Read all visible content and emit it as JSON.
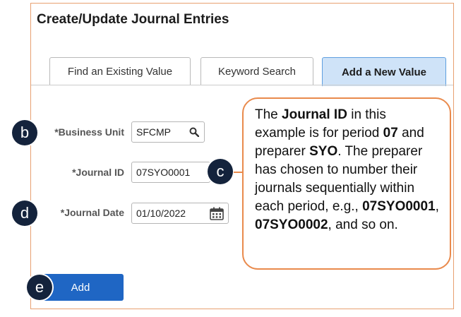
{
  "page": {
    "title": "Create/Update Journal Entries"
  },
  "tabs": [
    {
      "label": "Find an Existing Value",
      "selected": false
    },
    {
      "label": "Keyword Search",
      "selected": false
    },
    {
      "label": "Add a New Value",
      "selected": true
    }
  ],
  "form": {
    "business_unit": {
      "label": "*Business Unit",
      "value": "SFCMP"
    },
    "journal_id": {
      "label": "*Journal ID",
      "value": "07SYO0001"
    },
    "journal_date": {
      "label": "*Journal Date",
      "value": "01/10/2022"
    },
    "add_label": "Add"
  },
  "badges": {
    "b": "b",
    "c": "c",
    "d": "d",
    "e": "e"
  },
  "callout": {
    "t1": "The ",
    "b1": "Journal ID",
    "t2": " in this example is for period ",
    "b2": "07",
    "t3": " and preparer ",
    "b3": "SYO",
    "t4": ". The preparer has chosen to number their journals sequentially within each period, e.g., ",
    "b4": "07SYO0001",
    "t5": ", ",
    "b5": "07SYO0002",
    "t6": ", and so on."
  },
  "colors": {
    "accent": "#1f66c4",
    "selected_tab": "#cfe3f8",
    "callout_border": "#e98a4c",
    "badge": "#14233c"
  },
  "icons": {
    "search": "search-icon",
    "calendar": "calendar-icon"
  }
}
